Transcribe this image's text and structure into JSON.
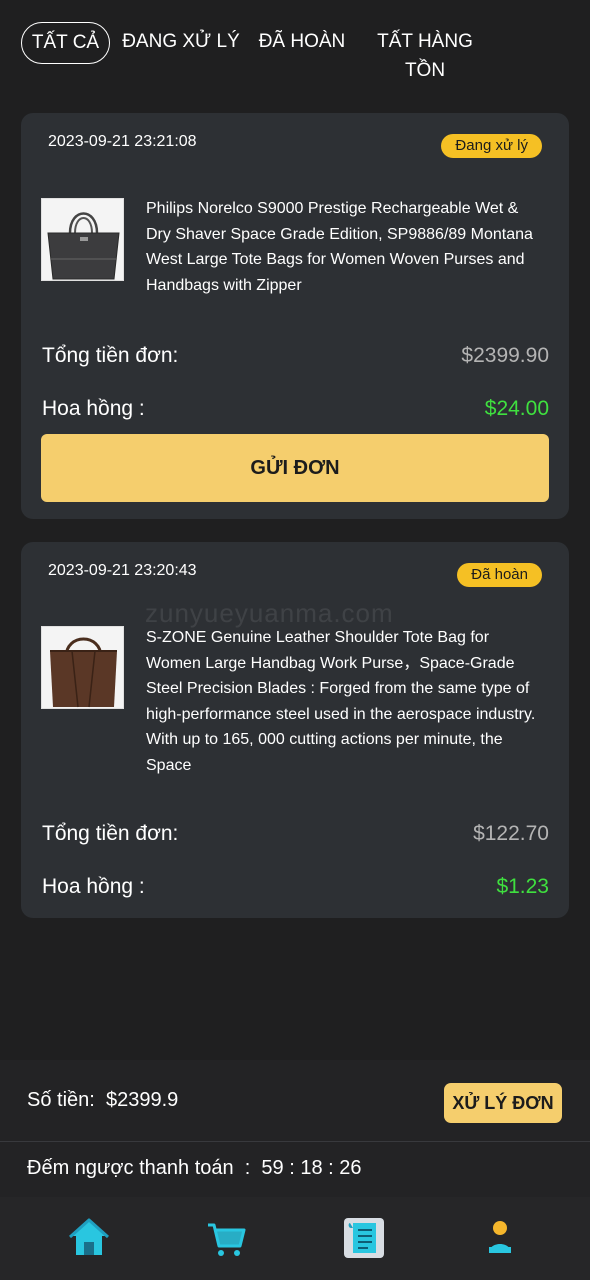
{
  "tabs": [
    {
      "label": "TẤT CẢ",
      "active": true
    },
    {
      "label": "ĐANG XỬ LÝ",
      "active": false
    },
    {
      "label": "ĐÃ HOÀN",
      "active": false
    },
    {
      "label_line1": "TẤT HÀNG",
      "label_line2": "TỒN",
      "active": false
    }
  ],
  "orders": [
    {
      "time": "2023-09-21 23:21:08",
      "status": "Đang xử lý",
      "title": "Philips Norelco S9000 Prestige Rechargeable Wet & Dry Shaver Space Grade Edition, SP9886/89 Montana West Large Tote Bags for Women Woven Purses and Handbags with Zipper",
      "total_label": "Tổng tiền đơn:",
      "total_value": "$2399.90",
      "commission_label": "Hoa hồng :",
      "commission_value": "$24.00",
      "button_label": "GỬI ĐƠN"
    },
    {
      "time": "2023-09-21 23:20:43",
      "status": "Đã hoàn",
      "title": "S-ZONE Genuine Leather Shoulder Tote Bag for Women Large Handbag Work Purse，Space-Grade Steel Precision Blades : Forged from the same type of high-performance steel used in the aerospace industry. With up to 165, 000 cutting actions per minute, the Space",
      "total_label": "Tổng tiền đơn:",
      "total_value": "$122.70",
      "commission_label": "Hoa hồng :",
      "commission_value": "$1.23"
    }
  ],
  "watermark": "zunyueyuanma.com",
  "footer": {
    "amount_label": "Số tiền:",
    "amount_value": "$2399.9",
    "process_button": "XỬ LÝ ĐƠN",
    "countdown_label": "Đếm ngược thanh toán",
    "countdown_value": "59 : 18 : 26"
  },
  "nav": [
    {
      "icon": "home-icon",
      "color": "#29c6e0"
    },
    {
      "icon": "cart-icon",
      "color": "#29c6e0"
    },
    {
      "icon": "orders-icon",
      "color": "#29c6e0"
    },
    {
      "icon": "user-icon",
      "color": "#29c6e0"
    }
  ],
  "colors": {
    "accent": "#f5ce6d",
    "badge": "#f5c024",
    "commission": "#3fe03f",
    "card": "#2d3034"
  }
}
